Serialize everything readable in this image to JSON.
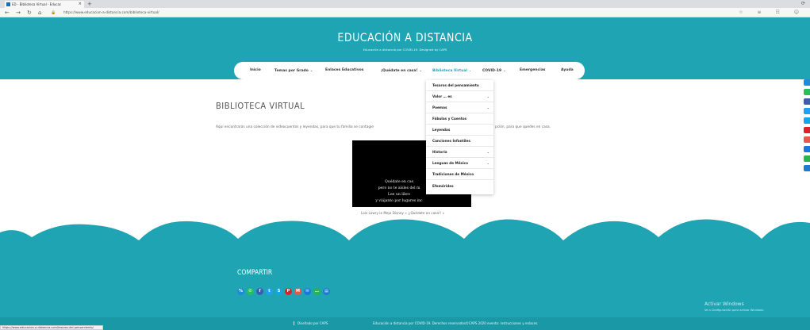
{
  "browser": {
    "tab_title": "ED - Biblioteca Virtual - Educac",
    "tab_close": "×",
    "new_tab": "+",
    "window_controls": "⟳",
    "url": "https://www.educacion-a-distancia.com/biblioteca-virtual/",
    "back": "←",
    "forward": "→",
    "refresh": "↻",
    "home": "⌂",
    "lock": "🔒",
    "right_icons": "☆ ≡ ☷ ☺",
    "status_url": "https://www.educacion-a-distancia.com/tesoros-del-pensamiento/"
  },
  "site": {
    "title": "EDUCACIÓN A DISTANCIA",
    "subtitle": "Educación a distancia por COVID-19. Designed by CAPS",
    "brand_color": "#1fa4b3"
  },
  "nav": {
    "items": [
      {
        "label": "Inicio",
        "caret": ""
      },
      {
        "label": "Temas por Grado",
        "caret": "⌄"
      },
      {
        "label": "Enlaces Educativos",
        "caret": ""
      },
      {
        "label": "¡Quédate en casa!",
        "caret": "⌄"
      },
      {
        "label": "Biblioteca Virtual",
        "caret": "⌄"
      },
      {
        "label": "COVID-19",
        "caret": "⌄"
      },
      {
        "label": "Emergencias",
        "caret": ""
      },
      {
        "label": "Ayuda",
        "caret": ""
      }
    ]
  },
  "dropdown": {
    "items": [
      {
        "label": "Tesoros del pensamiento",
        "caret": ""
      },
      {
        "label": "Valor … es",
        "caret": "⌄"
      },
      {
        "label": "Poemas",
        "caret": "⌄"
      },
      {
        "label": "Fábulas y Cuentos",
        "caret": ""
      },
      {
        "label": "Leyendas",
        "caret": ""
      },
      {
        "label": "Canciones Infantiles",
        "caret": ""
      },
      {
        "label": "Historia",
        "caret": "⌄"
      },
      {
        "label": "Lenguas de México",
        "caret": "⌄"
      },
      {
        "label": "Tradiciones de México",
        "caret": ""
      },
      {
        "label": "Efemérides",
        "caret": ""
      }
    ]
  },
  "content": {
    "title": "BIBLIOTECA VIRTUAL",
    "intro_left": "Aquí encontrarás una colección de videocuentos y leyendas, para que tu familia se contagie",
    "intro_right": "pción, para que quedes en casa.",
    "video_lines": [
      "Quédate en cas",
      "pero no te aísles del m",
      "Lee un libro",
      "y viájanto por lugares inc"
    ],
    "caption": "Lois Lowry ie Mejo Disney » ¡¡Quédate en casa!! »"
  },
  "footer": {
    "share_title": "COMPARTIR",
    "share_buttons": [
      {
        "icon": "link-icon",
        "glyph": "%",
        "color": "#1c8bd8"
      },
      {
        "icon": "whatsapp-icon",
        "glyph": "✆",
        "color": "#25c05c"
      },
      {
        "icon": "facebook-icon",
        "glyph": "f",
        "color": "#3b5dae"
      },
      {
        "icon": "twitter-icon",
        "glyph": "t",
        "color": "#1ea1f2"
      },
      {
        "icon": "skype-icon",
        "glyph": "S",
        "color": "#13a6e8"
      },
      {
        "icon": "pinterest-icon",
        "glyph": "P",
        "color": "#de2128"
      },
      {
        "icon": "gmail-icon",
        "glyph": "M",
        "color": "#e8574a"
      },
      {
        "icon": "email-icon",
        "glyph": "✉",
        "color": "#1877e0"
      },
      {
        "icon": "message-icon",
        "glyph": "…",
        "color": "#2ab34e"
      },
      {
        "icon": "print-icon",
        "glyph": "▤",
        "color": "#1c7ad0"
      }
    ],
    "left_text": "Diseñado por CAPS",
    "right_text": "Educación a distancia por COVID-19. Derechos reservados©CAPS 2020 evento: instrucciones y enlaces.",
    "activate_title": "Activar Windows",
    "activate_sub": "Ve a Configuración para activar Windows."
  },
  "side_share_colors": [
    "#1c8bd8",
    "#25c05c",
    "#3b5dae",
    "#1ea1f2",
    "#13a6e8",
    "#de2128",
    "#e8574a",
    "#1877e0",
    "#2ab34e",
    "#1c7ad0"
  ]
}
